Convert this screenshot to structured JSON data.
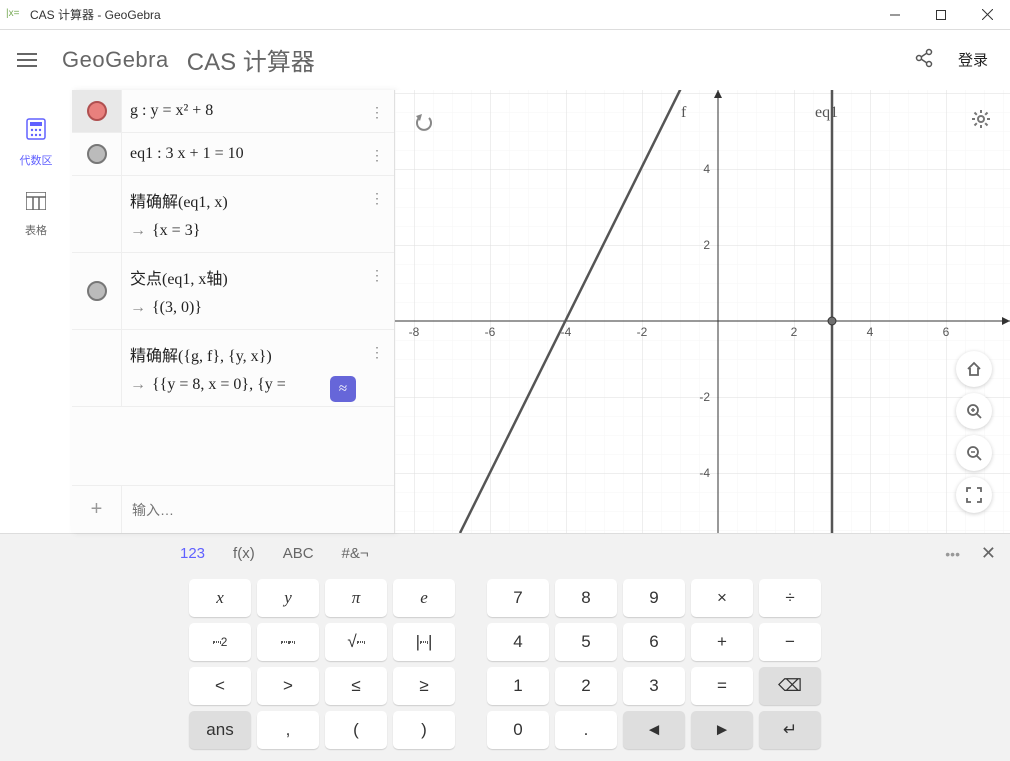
{
  "window": {
    "title": "CAS 计算器 - GeoGebra"
  },
  "header": {
    "logo": "GeoGebra",
    "app_title": "CAS 计算器",
    "login": "登录"
  },
  "side_nav": {
    "algebra": "代数区",
    "table": "表格"
  },
  "cas": {
    "rows": [
      {
        "expr": "g : y = x² + 8",
        "dot": "red",
        "selected": true
      },
      {
        "expr": "eq1 : 3 x + 1 = 10",
        "dot": "grey"
      },
      {
        "expr": "精确解(eq1, x)",
        "result": "{x = 3}"
      },
      {
        "expr": "交点(eq1, x轴)",
        "result": "{(3, 0)}",
        "dot": "grey"
      },
      {
        "expr": "精确解({g, f}, {y, x})",
        "result": "{{y = 8, x = 0}, {y =",
        "approx": true
      }
    ],
    "input_placeholder": "输入…"
  },
  "graph": {
    "labels": {
      "f": "f",
      "eq1": "eq1"
    },
    "x_ticks": [
      "-8",
      "-6",
      "-4",
      "-2",
      "2",
      "4",
      "6"
    ],
    "y_ticks": [
      "-4",
      "-2",
      "2",
      "4"
    ]
  },
  "keyboard": {
    "tabs": {
      "num": "123",
      "fx": "f(x)",
      "abc": "ABC",
      "sym": "#&¬"
    },
    "row1": [
      "x",
      "y",
      "π",
      "e",
      "7",
      "8",
      "9",
      "×",
      "÷"
    ],
    "row2": [
      "▫²",
      "▫▫",
      "√▫",
      "|▫|",
      "4",
      "5",
      "6",
      "+",
      "−"
    ],
    "row3": [
      "<",
      ">",
      "≤",
      "≥",
      "1",
      "2",
      "3",
      "=",
      "⌫"
    ],
    "row4": [
      "ans",
      ",",
      "(",
      ")",
      "0",
      ".",
      "◄",
      "►",
      "↵"
    ]
  },
  "chart_data": {
    "type": "line",
    "series": [
      {
        "name": "f",
        "equation": "y = 2x + 8",
        "type": "line"
      },
      {
        "name": "eq1",
        "equation": "x = 3",
        "type": "vertical_line"
      }
    ],
    "points": [
      {
        "x": 3,
        "y": 0
      }
    ],
    "xlim": [
      -9,
      7
    ],
    "ylim": [
      -5.5,
      5.5
    ],
    "x_ticks": [
      -8,
      -6,
      -4,
      -2,
      0,
      2,
      4,
      6
    ],
    "y_ticks": [
      -4,
      -2,
      0,
      2,
      4
    ],
    "title": "",
    "xlabel": "",
    "ylabel": ""
  }
}
